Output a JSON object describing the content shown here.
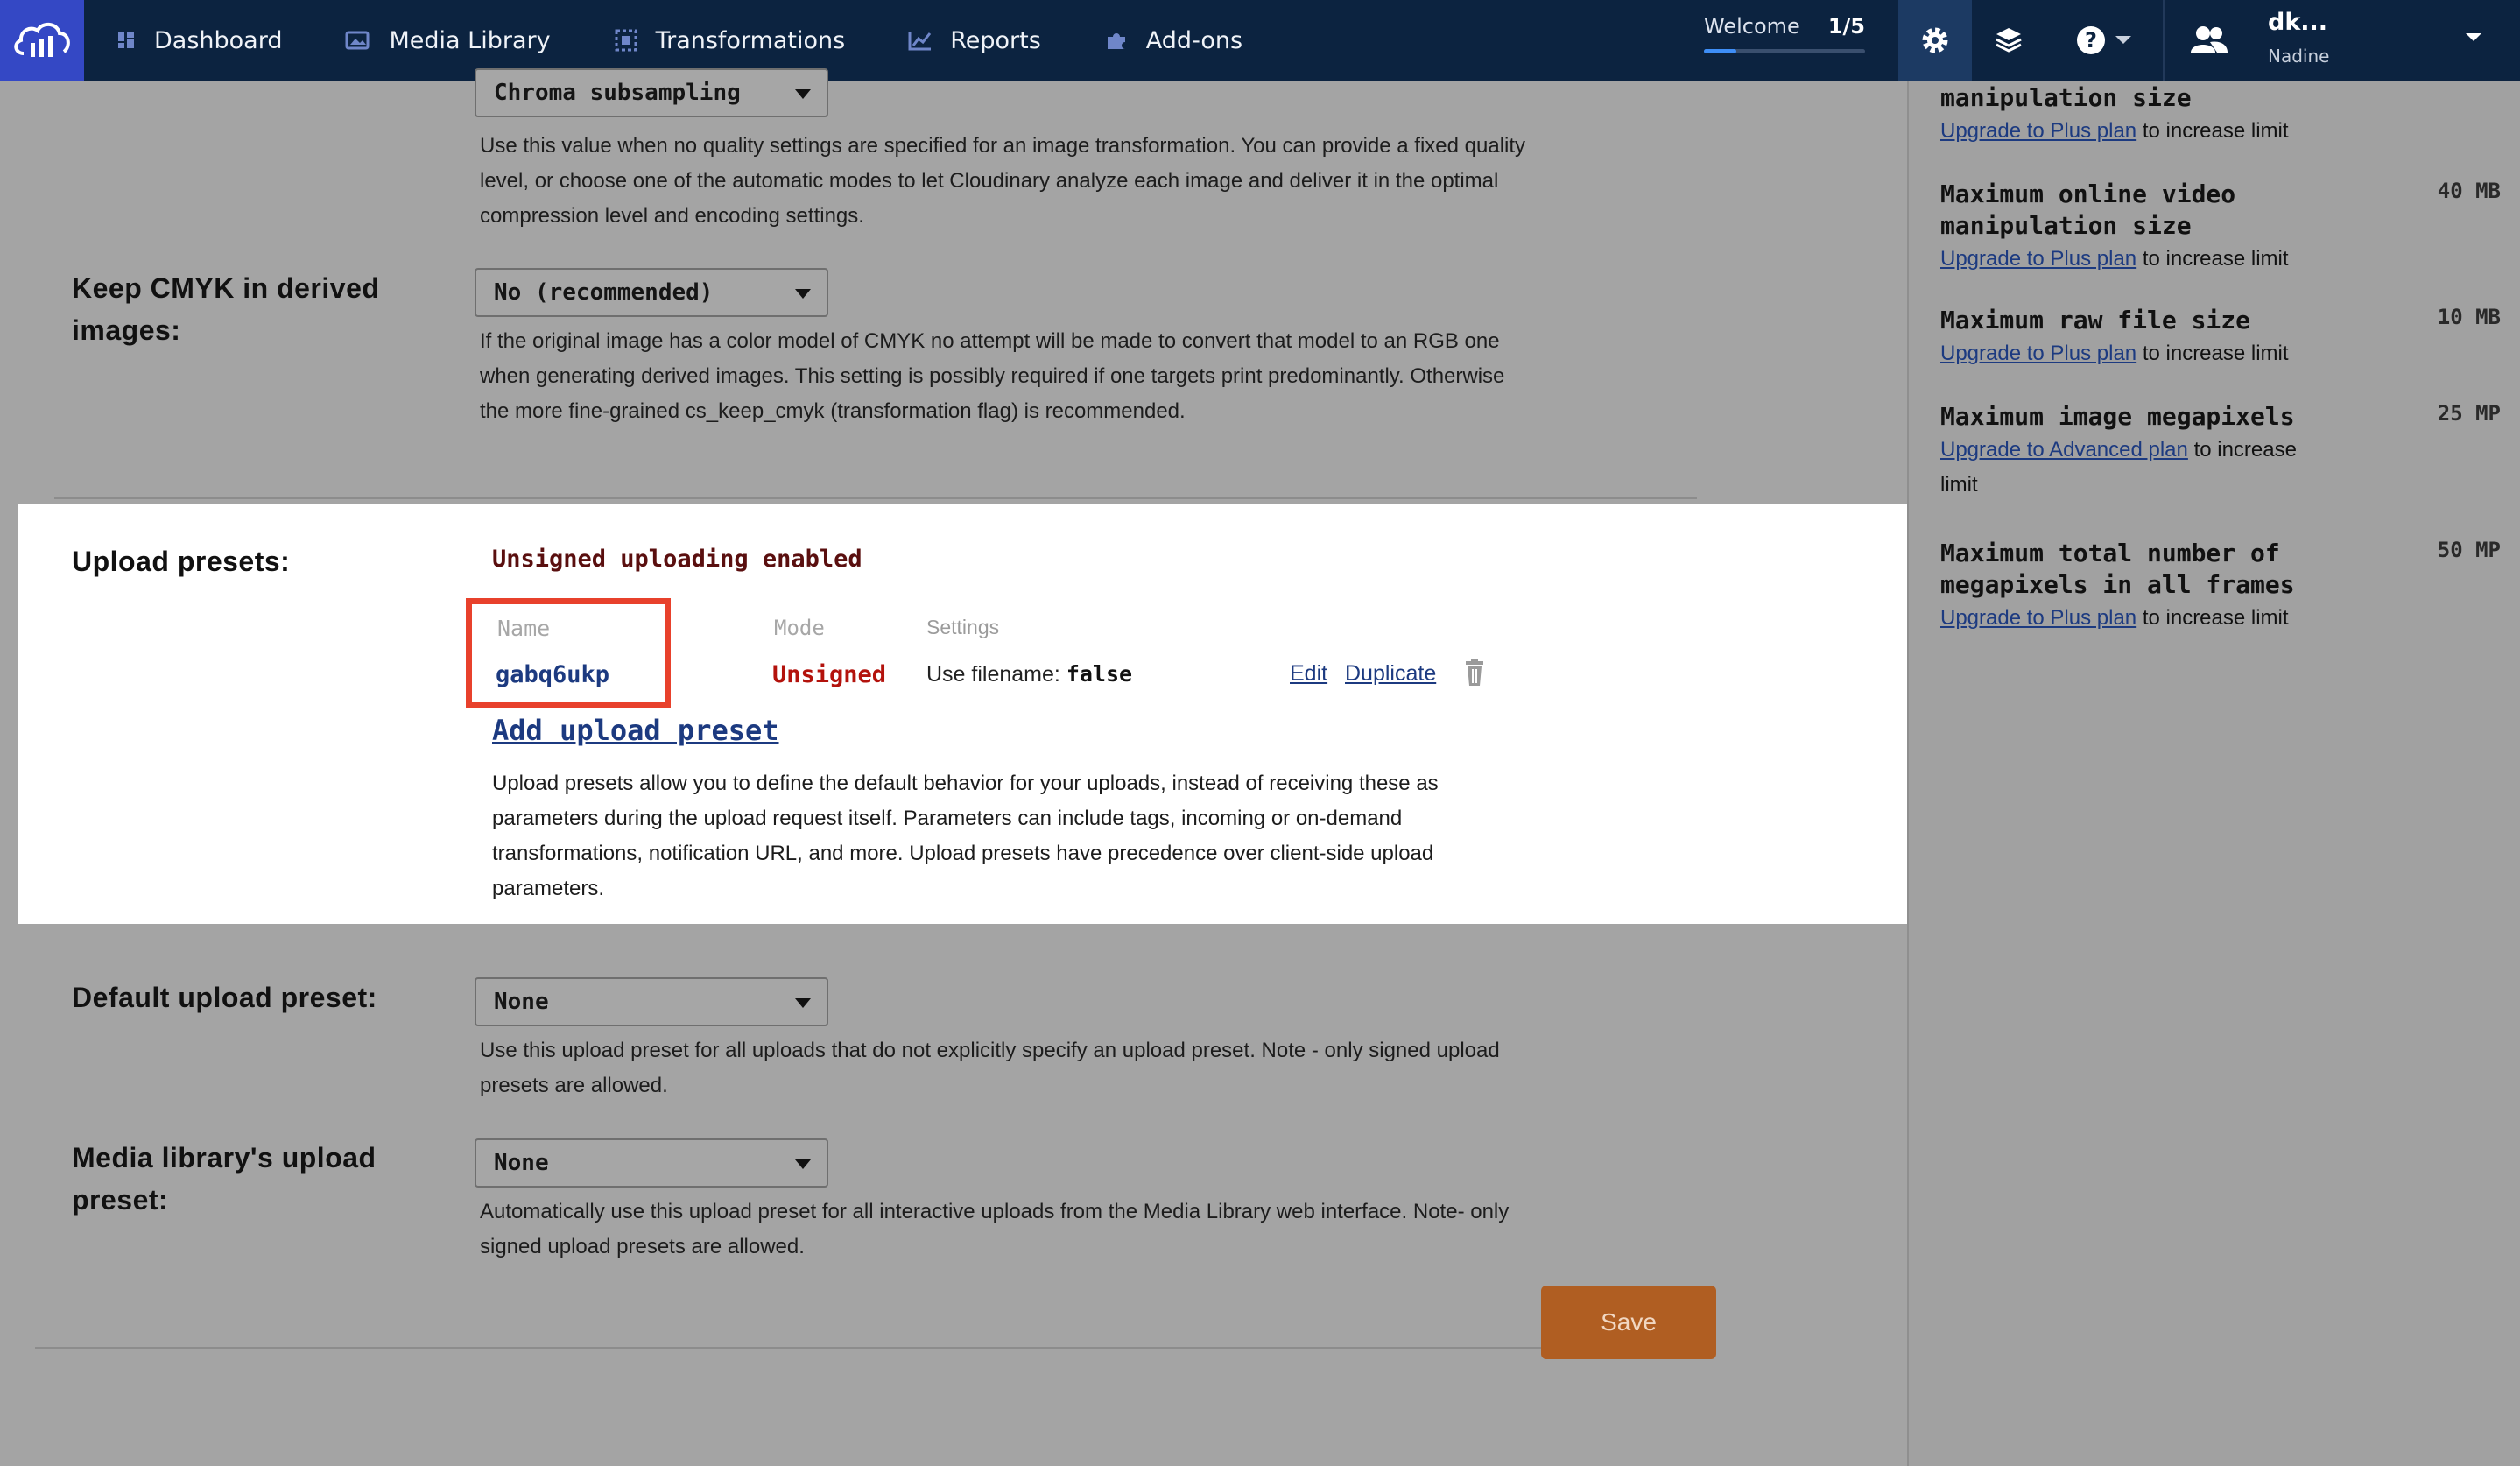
{
  "nav": {
    "items": [
      {
        "label": "Dashboard",
        "icon": "dashboard-icon"
      },
      {
        "label": "Media Library",
        "icon": "media-library-icon"
      },
      {
        "label": "Transformations",
        "icon": "transformations-icon"
      },
      {
        "label": "Reports",
        "icon": "reports-icon"
      },
      {
        "label": "Add-ons",
        "icon": "addons-icon"
      }
    ],
    "welcome_label": "Welcome",
    "welcome_progress": "1/5",
    "welcome_progress_fraction": 0.2,
    "user_short": "dk...",
    "user_name": "Nadine"
  },
  "settings": {
    "chroma": {
      "selected": "Chroma subsampling"
    },
    "quality_help": "Use this value when no quality settings are specified for an image transformation. You can provide a fixed quality level, or choose one of the automatic modes to let Cloudinary analyze each image and deliver it in the optimal compression level and encoding settings.",
    "cmyk": {
      "label": "Keep CMYK in derived images:",
      "selected": "No (recommended)",
      "help": "If the original image has a color model of CMYK no attempt will be made to convert that model to an RGB one when generating derived images. This setting is possibly required if one targets print predominantly. Otherwise the more fine-grained cs_keep_cmyk (transformation flag) is recommended."
    },
    "upload_presets": {
      "label": "Upload presets:",
      "status": "Unsigned uploading enabled",
      "columns": {
        "name": "Name",
        "mode": "Mode",
        "settings": "Settings"
      },
      "preset": {
        "name": "gabq6ukp",
        "mode": "Unsigned",
        "settings_key": "Use filename:",
        "settings_value": "false",
        "edit": "Edit",
        "duplicate": "Duplicate"
      },
      "add_label": "Add upload preset",
      "help": "Upload presets allow you to define the default behavior for your uploads, instead of receiving these as parameters during the upload request itself. Parameters can include tags, incoming or on-demand transformations, notification URL, and more. Upload presets have precedence over client-side upload parameters."
    },
    "default_preset": {
      "label": "Default upload preset:",
      "selected": "None",
      "help": "Use this upload preset for all uploads that do not explicitly specify an upload preset. Note - only signed upload presets are allowed."
    },
    "media_library_preset": {
      "label": "Media library's upload preset:",
      "selected": "None",
      "help": "Automatically use this upload preset for all interactive uploads from the Media Library web interface. Note- only signed upload presets are allowed."
    },
    "save_label": "Save"
  },
  "sidebar": {
    "limits": [
      {
        "title": "manipulation size",
        "value": "",
        "upgrade_link": "Upgrade to Plus plan",
        "upgrade_rest": "to increase limit"
      },
      {
        "title": "Maximum online video manipulation size",
        "value": "40 MB",
        "upgrade_link": "Upgrade to Plus plan",
        "upgrade_rest": "to increase limit"
      },
      {
        "title": "Maximum raw file size",
        "value": "10 MB",
        "upgrade_link": "Upgrade to Plus plan",
        "upgrade_rest": "to increase limit"
      },
      {
        "title": "Maximum image megapixels",
        "value": "25 MP",
        "upgrade_link": "Upgrade to Advanced plan",
        "upgrade_rest": "to increase limit"
      },
      {
        "title": "Maximum total number of megapixels in all frames",
        "value": "50 MP",
        "upgrade_link": "Upgrade to Plus plan",
        "upgrade_rest": "to increase limit"
      }
    ]
  },
  "colors": {
    "topbar": "#0c2340",
    "brand": "#3448c5",
    "highlight": "#e8412c",
    "unsigned": "#b3120c",
    "save": "#b05e22"
  }
}
